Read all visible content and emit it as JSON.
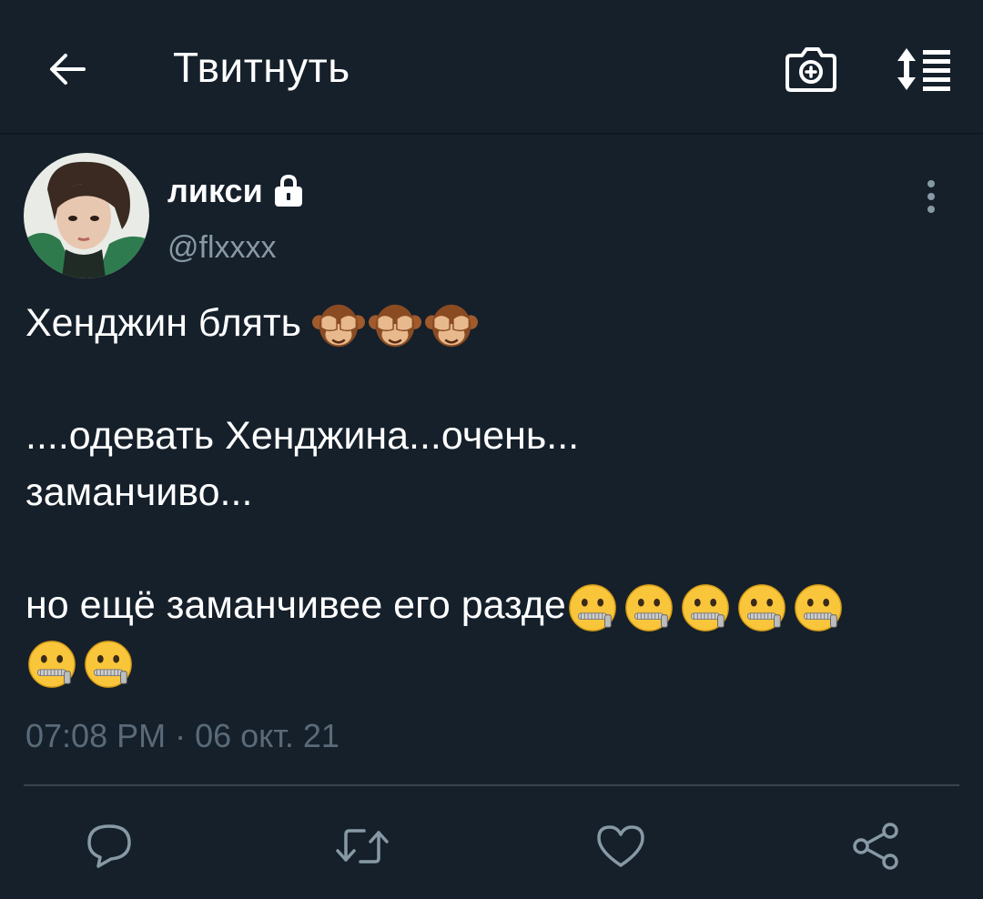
{
  "header": {
    "title": "Твитнуть",
    "back_icon": "arrow-left-icon",
    "camera_icon": "camera-plus-icon",
    "sort_icon": "sort-list-icon"
  },
  "tweet": {
    "user_name": "ликси",
    "user_handle": "@flxxxx",
    "protected_icon": "lock-icon",
    "more_icon": "vertical-dots-icon",
    "lines": [
      "Хенджин блять",
      "....одевать Хенджина...очень...",
      "заманчиво...",
      "но ещё заманчивее его разде"
    ],
    "emoji": {
      "line1": "see-no-evil-monkey",
      "line1_count": 3,
      "line4": "zipper-mouth-face",
      "line4_count": 5,
      "line5_count": 2
    },
    "time": "07:08 PM",
    "separator": "·",
    "date": "06 окт. 21"
  },
  "actions": {
    "reply_icon": "reply-bubble-icon",
    "retweet_icon": "retweet-icon",
    "like_icon": "heart-icon",
    "share_icon": "share-icon"
  },
  "colors": {
    "background": "#15202b",
    "secondary_text": "#8899a6",
    "divider": "#38444d",
    "icon": "#8899a6"
  }
}
